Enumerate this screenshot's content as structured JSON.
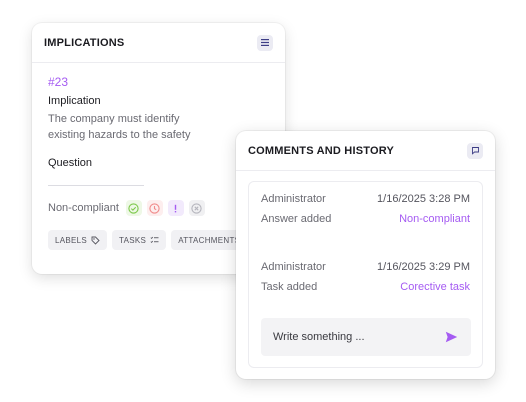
{
  "implications": {
    "title": "IMPLICATIONS",
    "number": "#23",
    "implication_label": "Implication",
    "implication_text": "The company must identify existing  hazards to the safety",
    "question_label": "Question",
    "status": "Non-compliant",
    "tags": [
      {
        "label": "LABELS",
        "icon": "tag-icon"
      },
      {
        "label": "TASKS",
        "icon": "list-icon"
      },
      {
        "label": "ATTACHMENTS",
        "icon": "paperclip-icon"
      }
    ]
  },
  "comments": {
    "title": "COMMENTS AND HISTORY",
    "history": [
      {
        "user": "Administrator",
        "time": "1/16/2025 3:28 PM",
        "action": "Answer added",
        "value": "Non-compliant"
      },
      {
        "user": "Administrator",
        "time": "1/16/2025 3:29 PM",
        "action": "Task added",
        "value": "Corective task"
      }
    ],
    "input_placeholder": "Write something ..."
  },
  "colors": {
    "accent": "#a55bf2",
    "ok": "#7cc84a",
    "danger": "#f08a8a",
    "neutral": "#b5b5bd"
  }
}
